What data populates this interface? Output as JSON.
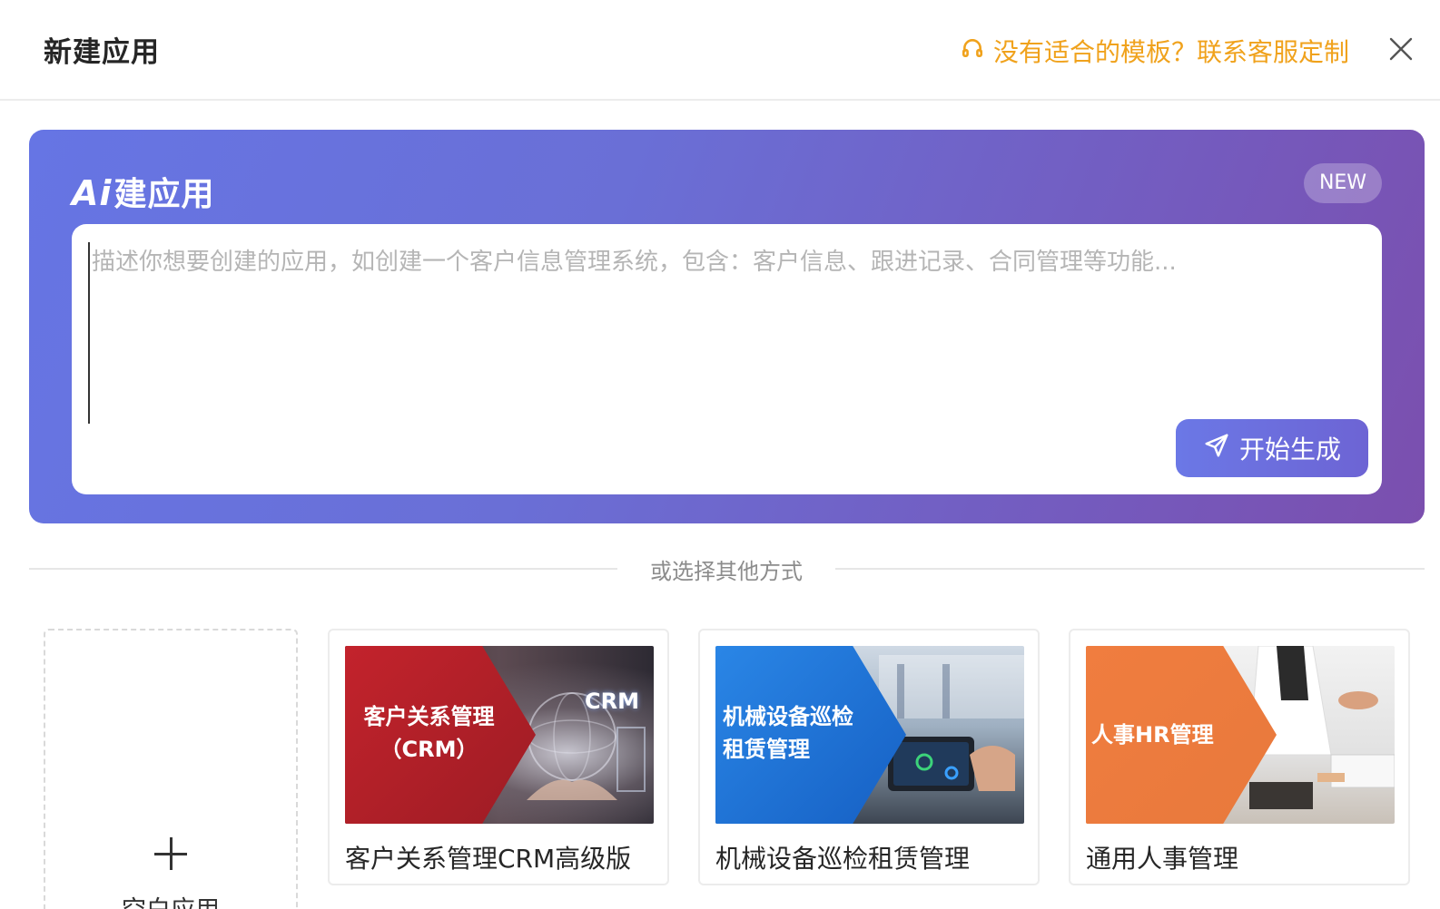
{
  "header": {
    "title": "新建应用",
    "help_text": "没有适合的模板？联系客服定制",
    "help_icon": "headset-icon",
    "close_icon": "close-icon",
    "help_color": "#f0a21c"
  },
  "ai_builder": {
    "title_mark": "Ai",
    "title": "建应用",
    "badge": "NEW",
    "prompt_placeholder": "描述你想要创建的应用，如创建一个客户信息管理系统，包含：客户信息、跟进记录、合同管理等功能...",
    "prompt_value": "",
    "generate_label": "开始生成",
    "generate_icon": "send-icon"
  },
  "divider": {
    "text": "或选择其他方式"
  },
  "blank_app": {
    "label": "空白应用",
    "icon": "plus-icon"
  },
  "templates": [
    {
      "image_text": "客户关系管理\n（CRM）",
      "image_badge": "CRM",
      "name": "客户关系管理CRM高级版",
      "accent": "#b3232b"
    },
    {
      "image_text": "机械设备巡检\n租赁管理",
      "name": "机械设备巡检租赁管理",
      "accent": "#1f73d6"
    },
    {
      "image_text": "人事HR管理",
      "name": "通用人事管理",
      "accent": "#ee7d3e"
    }
  ]
}
